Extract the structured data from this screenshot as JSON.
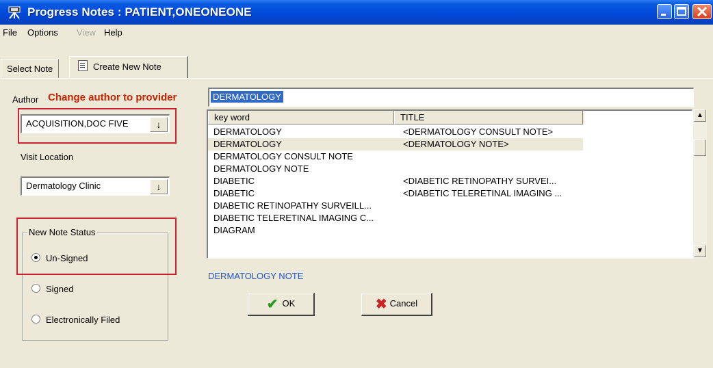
{
  "window": {
    "title": "Progress Notes : PATIENT,ONEONEONE"
  },
  "menu": {
    "items": [
      {
        "label": "File",
        "disabled": false
      },
      {
        "label": "Options",
        "disabled": false
      },
      {
        "label": "View",
        "disabled": true
      },
      {
        "label": "Help",
        "disabled": false
      }
    ]
  },
  "tabs": [
    {
      "label": "Select Note"
    },
    {
      "label": "Create New Note"
    }
  ],
  "form": {
    "author_label": "Author",
    "change_author_label": "Change author to provider",
    "author_value": "ACQUISITION,DOC FIVE",
    "visit_location_label": "Visit Location",
    "visit_location_value": "Dermatology Clinic",
    "title_search_value": "DERMATOLOGY",
    "status_group_label": "New Note Status",
    "status_options": [
      {
        "label": "Un-Signed",
        "checked": true
      },
      {
        "label": "Signed",
        "checked": false
      },
      {
        "label": "Electronically Filed",
        "checked": false
      }
    ],
    "selected_title_label": "DERMATOLOGY NOTE",
    "ok_label": "OK",
    "cancel_label": "Cancel"
  },
  "list": {
    "columns": [
      "key word",
      "TITLE"
    ],
    "rows": [
      {
        "keyword": "DERMATOLOGY",
        "title": "<DERMATOLOGY CONSULT NOTE>"
      },
      {
        "keyword": "DERMATOLOGY",
        "title": "<DERMATOLOGY NOTE>",
        "selected": true
      },
      {
        "keyword": "DERMATOLOGY CONSULT NOTE",
        "title": ""
      },
      {
        "keyword": "DERMATOLOGY NOTE",
        "title": ""
      },
      {
        "keyword": "DIABETIC",
        "title": "<DIABETIC RETINOPATHY SURVEI..."
      },
      {
        "keyword": "DIABETIC",
        "title": "<DIABETIC TELERETINAL IMAGING ..."
      },
      {
        "keyword": "DIABETIC RETINOPATHY SURVEILL...",
        "title": ""
      },
      {
        "keyword": "DIABETIC TELERETINAL IMAGING C...",
        "title": ""
      },
      {
        "keyword": "DIAGRAM",
        "title": ""
      }
    ]
  },
  "colors": {
    "title_bar": "#0047d8",
    "highlight": "#cc2200",
    "selection": "#316ac5",
    "link_blue": "#2255cc"
  }
}
